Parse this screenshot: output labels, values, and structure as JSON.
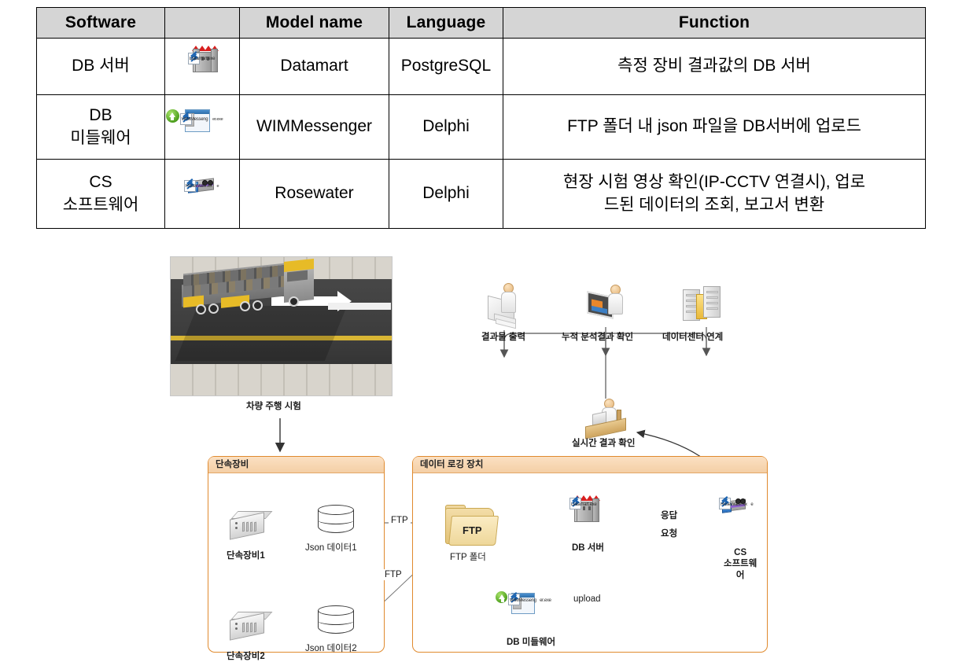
{
  "table": {
    "headers": [
      "Software",
      "Model  name",
      "Language",
      "Function"
    ],
    "rows": [
      {
        "software": "DB 서버",
        "icon_name": "datamart-exe-icon",
        "icon_caption": "Datamart.exe",
        "icon_caption2": "",
        "model": "Datamart",
        "language": "PostgreSQL",
        "function": "측정 장비 결과값의 DB 서버"
      },
      {
        "software_line1": "DB",
        "software_line2": "미들웨어",
        "icon_name": "wimmessenger-exe-icon",
        "icon_caption": "WIMMesseng",
        "icon_caption2": "er.exe",
        "model": "WIMMessenger",
        "language": "Delphi",
        "function": "FTP 폴더 내 json 파일을 DB서버에 업로드"
      },
      {
        "software_line1": "CS",
        "software_line2": "소프트웨어",
        "icon_name": "rosewater-exe-icon",
        "icon_caption": "RoseWater.ex",
        "icon_caption2": "e",
        "model": "Rosewater",
        "language": "Delphi",
        "function_line1": "현장 시험 영상 확인(IP-CCTV 연결시), 업로",
        "function_line2": "드된 데이터의 조회, 보고서 변환"
      }
    ]
  },
  "diagram": {
    "road_label": "차량 주행 시험",
    "top_icons": [
      {
        "label": "결과물 출력",
        "icon": "printer-person-icon"
      },
      {
        "label": "누적 분석결과 확인",
        "icon": "monitor-person-icon"
      },
      {
        "label": "데이터센터 연계",
        "icon": "datacenter-icon"
      }
    ],
    "operator": {
      "label": "실시간 결과 확인",
      "icon": "desk-person-icon"
    },
    "left_box": {
      "title": "단속장비",
      "devices": [
        {
          "device": "단속장비1",
          "data": "Json 데이터1"
        },
        {
          "device": "단속장비2",
          "data": "Json 데이터2"
        }
      ]
    },
    "right_box": {
      "title": "데이터 로깅 장치",
      "ftp_folder": {
        "label": "FTP 폴더",
        "badge": "FTP"
      },
      "db_server": {
        "label": "DB 서버",
        "icon_caption": "Datamart.exe"
      },
      "middleware": {
        "label": "DB 미들웨어",
        "icon_caption": "WIMMesseng",
        "icon_caption2": "er.exe"
      },
      "cs_software": {
        "label_line1": "CS",
        "label_line2": "소프트웨",
        "label_line3": "어",
        "icon_caption": "RoseWater.ex",
        "icon_caption2": "e"
      }
    },
    "edge_labels": {
      "ftp_top": "FTP",
      "ftp_bottom": "FTP",
      "upload": "upload",
      "response": "응답",
      "request": "요청"
    }
  },
  "colors": {
    "table_header_bg": "#d5d5d5",
    "group_box_border": "#e08a2e",
    "group_box_header": "#f4cfa6"
  }
}
